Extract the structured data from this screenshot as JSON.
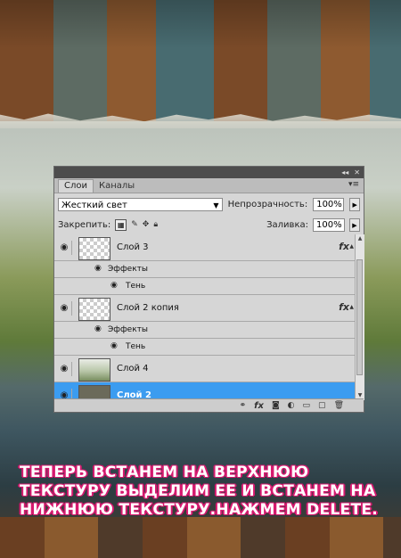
{
  "panel": {
    "window_buttons": [
      "◂◂",
      "✕"
    ],
    "tabs": [
      {
        "label": "Слои",
        "active": true
      },
      {
        "label": "Каналы",
        "active": false
      }
    ],
    "blend_mode": "Жесткий свет",
    "opacity_label": "Непрозрачность:",
    "opacity_value": "100%",
    "lock_label": "Закрепить:",
    "fill_label": "Заливка:",
    "fill_value": "100%",
    "layers": [
      {
        "name": "Слой 3",
        "has_fx": true,
        "effects_label": "Эффекты",
        "effect": "Тень"
      },
      {
        "name": "Слой 2 копия",
        "has_fx": true,
        "effects_label": "Эффекты",
        "effect": "Тень"
      },
      {
        "name": "Слой 4",
        "has_fx": false
      },
      {
        "name": "Слой 2",
        "has_fx": false,
        "selected": true
      }
    ],
    "fx_symbol": "fx",
    "selected_color": "#3b9cf0"
  },
  "caption": {
    "line1": "ТЕПЕРЬ ВСТАНЕМ НА ВЕРХНЮЮ",
    "line2": "ТЕКСТУРУ ВЫДЕЛИМ ЕЕ И ВСТАНЕМ НА",
    "line3": "НИЖНЮЮ ТЕКСТУРУ.НАЖМЕМ DELETE.",
    "text_color": "#ffffff",
    "outline_color": "#d6196f"
  }
}
